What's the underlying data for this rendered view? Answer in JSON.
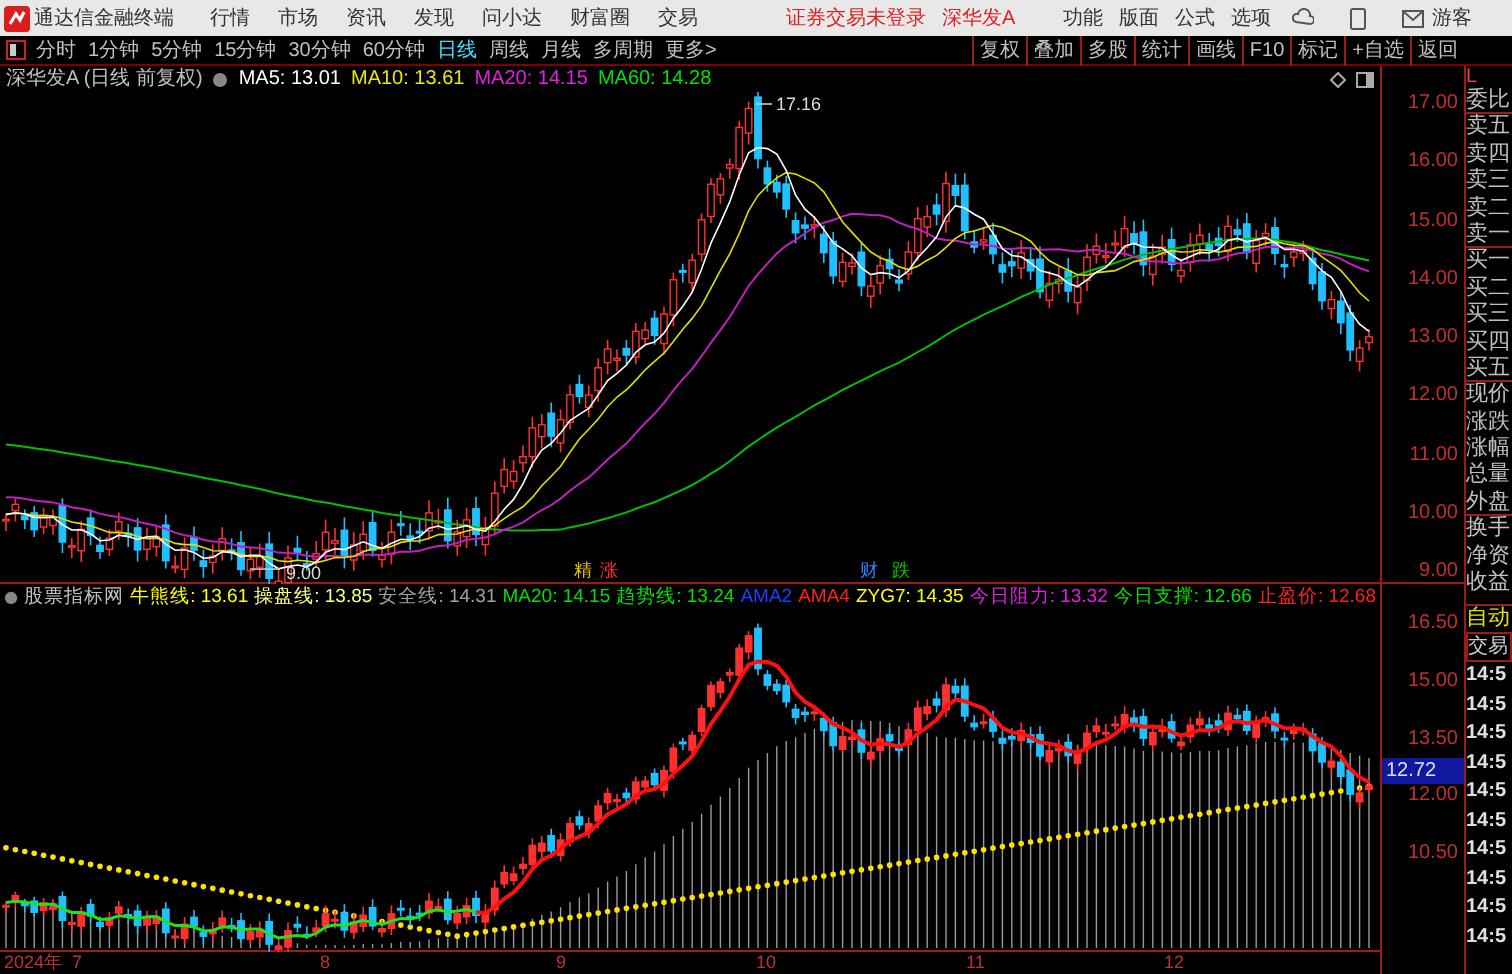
{
  "app": {
    "name": "通达信金融终端",
    "menu": [
      "行情",
      "市场",
      "资讯",
      "发现",
      "问小达",
      "财富圈",
      "交易"
    ],
    "login_status": "证券交易未登录",
    "stock": "深华发A",
    "right_menu": [
      "功能",
      "版面",
      "公式",
      "选项"
    ],
    "user": "游客"
  },
  "toolbar": {
    "periods": [
      {
        "label": "分时",
        "selected": false
      },
      {
        "label": "1分钟",
        "selected": false
      },
      {
        "label": "5分钟",
        "selected": false
      },
      {
        "label": "15分钟",
        "selected": false
      },
      {
        "label": "30分钟",
        "selected": false
      },
      {
        "label": "60分钟",
        "selected": false
      },
      {
        "label": "日线",
        "selected": true
      },
      {
        "label": "周线",
        "selected": false
      },
      {
        "label": "月线",
        "selected": false
      },
      {
        "label": "多周期",
        "selected": false
      }
    ],
    "more": "更多>",
    "buttons": [
      "复权",
      "叠加",
      "多股",
      "统计",
      "画线",
      "F10",
      "标记",
      "+自选",
      "返回"
    ]
  },
  "main_chart": {
    "title": "深华发A (日线 前复权)",
    "indicators": [
      {
        "label": "MA5: 13.01",
        "color": "#ffffff"
      },
      {
        "label": "MA10: 13.61",
        "color": "#e8e800"
      },
      {
        "label": "MA20: 14.15",
        "color": "#e020e0"
      },
      {
        "label": "MA60: 14.28",
        "color": "#00e000"
      }
    ],
    "y_labels": [
      "17.00",
      "16.00",
      "15.00",
      "14.00",
      "13.00",
      "12.00",
      "11.00",
      "10.00",
      "9.00"
    ],
    "high_label": "17.16",
    "low_label": "9.00",
    "signals": [
      {
        "text": "精",
        "color": "#e8c000"
      },
      {
        "text": "涨",
        "color": "#ff3030"
      },
      {
        "text": "财",
        "color": "#4080ff"
      },
      {
        "text": "跌",
        "color": "#00d000"
      }
    ]
  },
  "indicator_chart": {
    "name": "股票指标网",
    "values": [
      {
        "label": "牛熊线: 13.61",
        "color": "#ffff00"
      },
      {
        "label": "操盘线: 13.85",
        "color": "#ffff80"
      },
      {
        "label": "安全线: 14.31",
        "color": "#a0a0a0"
      },
      {
        "label": "MA20: 14.15",
        "color": "#00e000"
      },
      {
        "label": "趋势线: 13.24",
        "color": "#00e000"
      },
      {
        "label": "AMA2",
        "color": "#2040ff"
      },
      {
        "label": "AMA4",
        "color": "#ff2020"
      },
      {
        "label": "ZYG7: 14.35",
        "color": "#ffff00"
      },
      {
        "label": "今日阻力: 13.32",
        "color": "#e020e0"
      },
      {
        "label": "今日支撑: 12.66",
        "color": "#00e000"
      },
      {
        "label": "止盈价: 12.68",
        "color": "#ff2020"
      }
    ],
    "y_labels": [
      "16.50",
      "15.00",
      "13.50",
      "12.00",
      "10.50"
    ],
    "current": "12.72"
  },
  "date_axis": [
    "2024年",
    "7",
    "8",
    "9",
    "10",
    "11",
    "12"
  ],
  "side_panel": {
    "corner": "L",
    "quote_fields": [
      "委比",
      "卖五",
      "卖四",
      "卖三",
      "卖二",
      "卖一",
      "买一",
      "买二",
      "买三",
      "买四",
      "买五",
      "现价",
      "涨跌",
      "涨幅",
      "总量",
      "外盘",
      "换手",
      "净资",
      "收益"
    ],
    "auto": "自动",
    "trade": "交易",
    "times": [
      "14:5",
      "14:5",
      "14:5",
      "14:5",
      "14:5",
      "14:5",
      "14:5",
      "14:5",
      "14:5",
      "14:5"
    ]
  }
}
